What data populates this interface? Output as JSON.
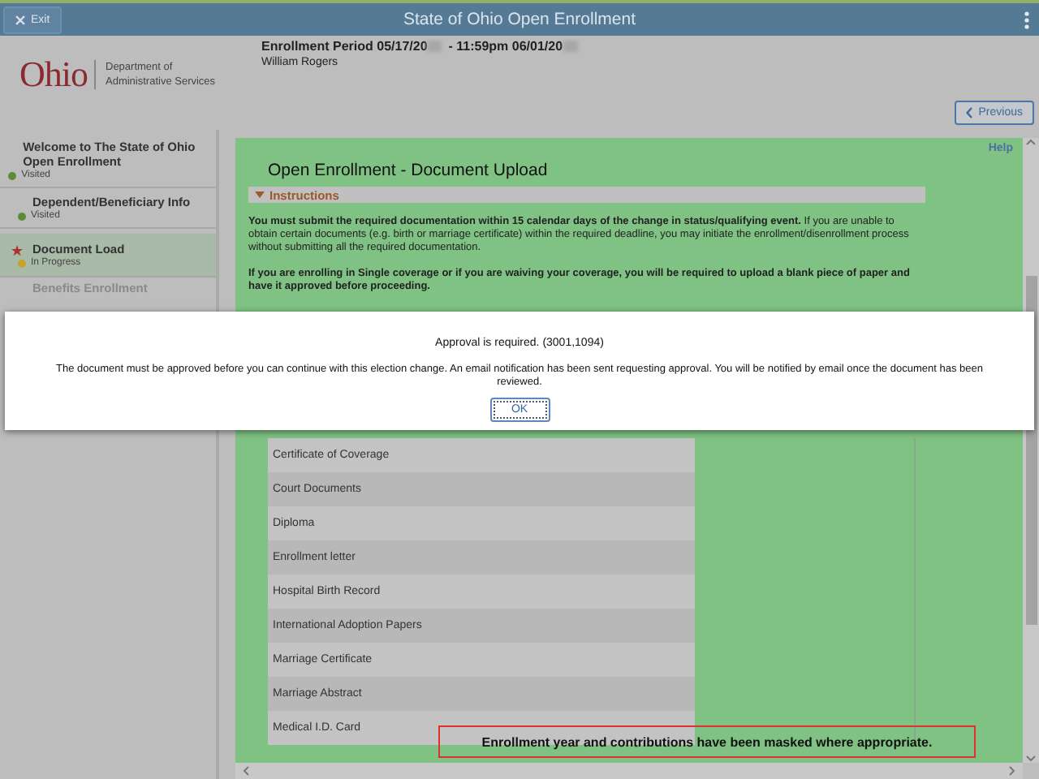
{
  "window": {
    "title": "State of Ohio Open Enrollment",
    "exit_button": "Exit"
  },
  "header": {
    "logo": "Ohio",
    "department": "Department of Administrative Services",
    "period_label": "Enrollment Period 05/17/20",
    "period_end": "- 11:59pm 06/01/20",
    "employee": "William Rogers",
    "previous_button": "Previous"
  },
  "sidebar": {
    "items": [
      {
        "label": "Welcome to The State of Ohio Open Enrollment",
        "status": "Visited",
        "color": "#5e8a3a",
        "selected": false,
        "disabled": false
      },
      {
        "label": "Dependent/Beneficiary Info",
        "status": "Visited",
        "color": "#5e8a3a",
        "selected": false,
        "disabled": false
      },
      {
        "label": "Document Load",
        "status": "In Progress",
        "color": "#c9a227",
        "selected": true,
        "disabled": false
      },
      {
        "label": "Benefits Enrollment",
        "selected": false,
        "disabled": true
      }
    ]
  },
  "main": {
    "title": "Open Enrollment - Document Upload",
    "help_link": "Help",
    "instructions": {
      "label": "Instructions",
      "expanded": true,
      "paragraphs": [
        "**You must submit the required documentation within 15 calendar days of the change in status/qualifying event.** If you are unable to obtain certain documents (e.g. birth or marriage certificate) within the required deadline, you may initiate the enrollment/disenrollment process without submitting all the required documentation.",
        "**If you are enrolling in Single coverage or if you are waiving your coverage, you will be required to upload a blank piece of paper and have it approved before proceeding.**"
      ]
    },
    "documents": [
      "Certificate of Coverage",
      "Court Documents",
      "Diploma",
      "Enrollment letter",
      "Hospital Birth Record",
      "International Adoption Papers",
      "Marriage Certificate",
      "Marriage Abstract",
      "Medical I.D. Card"
    ]
  },
  "modal": {
    "title": "Approval is required. (3001,1094)",
    "message": "The document must be approved before you can continue with this election change. An email notification has been sent requesting approval. You will be notified by email once the document has been reviewed.",
    "ok_button": "OK"
  },
  "note": "Enrollment year and contributions have been masked where appropriate."
}
